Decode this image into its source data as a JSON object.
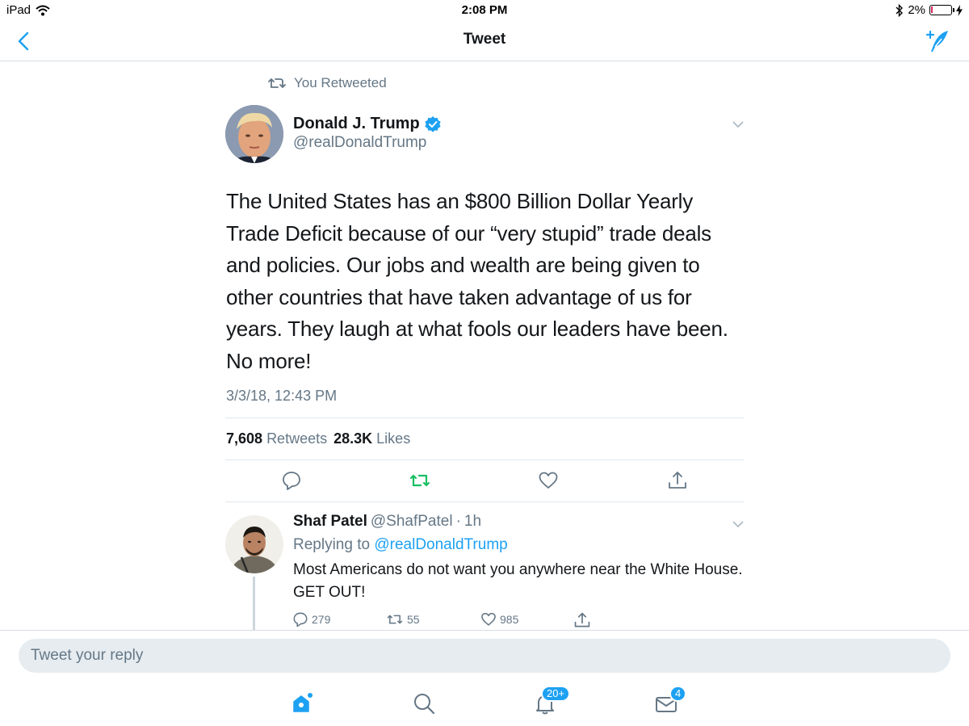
{
  "status_bar": {
    "device": "iPad",
    "time": "2:08 PM",
    "battery": "2%"
  },
  "nav": {
    "title": "Tweet"
  },
  "retweet": {
    "label": "You Retweeted"
  },
  "tweet": {
    "name": "Donald J. Trump",
    "handle": "@realDonaldTrump",
    "text": "The United States has an $800 Billion Dollar Yearly Trade Deficit because of our “very stupid” trade deals and policies. Our jobs and wealth are being given to other countries that have taken advantage of us for years. They laugh at what fools our leaders have been. No more!",
    "timestamp": "3/3/18, 12:43 PM",
    "retweets_count": "7,608",
    "retweets_label": "Retweets",
    "likes_count": "28.3K",
    "likes_label": "Likes"
  },
  "reply": {
    "name": "Shaf Patel",
    "handle": "@ShafPatel",
    "separator": "·",
    "time": "1h",
    "replying_label": "Replying to",
    "replying_handle": "@realDonaldTrump",
    "text": "Most Americans do not want you anywhere near the White House. GET OUT!",
    "replies": "279",
    "retweets": "55",
    "likes": "985"
  },
  "reply_box": {
    "placeholder": "Tweet your reply"
  },
  "tabs": {
    "notifications_badge": "20+",
    "messages_badge": "4"
  },
  "colors": {
    "accent": "#1da1f2",
    "retweet_green": "#17bf63",
    "muted": "#657786",
    "battery_red": "#e0245e"
  },
  "icons": [
    "wifi-icon",
    "bluetooth-icon",
    "battery-icon",
    "back-chevron-icon",
    "compose-icon",
    "retweet-icon",
    "verified-badge-icon",
    "chevron-down-icon",
    "reply-icon",
    "like-icon",
    "share-icon",
    "home-icon",
    "search-icon",
    "notifications-icon",
    "messages-icon"
  ]
}
